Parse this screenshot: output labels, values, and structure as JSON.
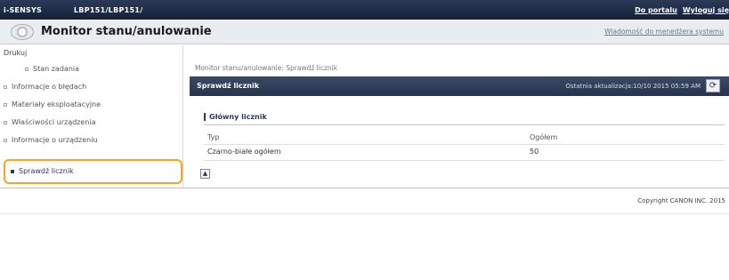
{
  "top": {
    "brand": "i-SENSYS",
    "model": "LBP151/LBP151/",
    "portal_link": "Do portalu",
    "logout_link": "Wyloguj się"
  },
  "header": {
    "title": "Monitor stanu/anulowanie",
    "message_link": "Wiadomość do menedżera systemu"
  },
  "sidebar": {
    "items": [
      {
        "label": "Drukuj"
      },
      {
        "label": "Stan zadania"
      },
      {
        "label": "Informacje o błędach"
      },
      {
        "label": "Materiały eksploatacyjne"
      },
      {
        "label": "Właściwości urządzenia"
      },
      {
        "label": "Informacje o urządzeniu"
      },
      {
        "label": "Sprawdź licznik"
      }
    ]
  },
  "main": {
    "breadcrumb": "Monitor stanu/anulowanie: Sprawdź licznik",
    "panel_title": "Sprawdź licznik",
    "last_update": "Ostatnia aktualizacja:10/10 2015 05:59 AM",
    "section_title": "Główny licznik",
    "table": {
      "headers": [
        "Typ",
        "Ogółem"
      ],
      "rows": [
        [
          "Czarno-białe ogółem",
          "50"
        ]
      ]
    }
  },
  "footer": {
    "copyright": "Copyright CANON INC. 2015"
  },
  "colors": {
    "topbar": "#1f2a44",
    "panel_header": "#2f3c58",
    "highlight": "#f3a42a"
  },
  "icons": {
    "title_icon": "monitor-status-icon",
    "refresh": "refresh-icon",
    "scroll": "scroll-top-icon"
  }
}
